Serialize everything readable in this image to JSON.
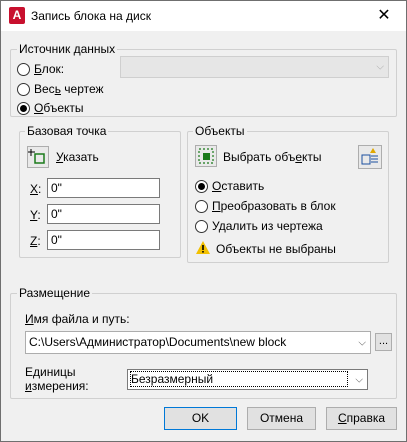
{
  "window": {
    "title": "Запись блока на диск",
    "close_label": "✕",
    "app_badge": "A"
  },
  "source": {
    "group_label": "Источник данных",
    "radio_block": "Блок:",
    "radio_drawing": "Весь чертеж",
    "radio_objects": "Объекты",
    "selected": "objects",
    "block_combo_value": ""
  },
  "base_point": {
    "group_label": "Базовая точка",
    "pick_label": "Указать",
    "x_label": "X:",
    "y_label": "Y:",
    "z_label": "Z:",
    "x": "0\"",
    "y": "0\"",
    "z": "0\""
  },
  "objects": {
    "group_label": "Объекты",
    "select_label": "Выбрать объекты",
    "radio_retain": "Оставить",
    "radio_convert": "Преобразовать в блок",
    "radio_delete": "Удалить из чертежа",
    "selected": "retain",
    "status_text": "Объекты не выбраны"
  },
  "destination": {
    "group_label": "Размещение",
    "path_label": "Имя файла и путь:",
    "path_value": "C:\\Users\\Администратор\\Documents\\new block",
    "browse_label": "...",
    "units_label_line1": "Единицы",
    "units_label_line2": "измерения:",
    "units_value": "Безразмерный"
  },
  "buttons": {
    "ok": "OK",
    "cancel": "Отмена",
    "help": "Справка"
  },
  "colors": {
    "accent": "#0078d7",
    "app_red": "#c8102e",
    "warning": "#f2c000"
  }
}
